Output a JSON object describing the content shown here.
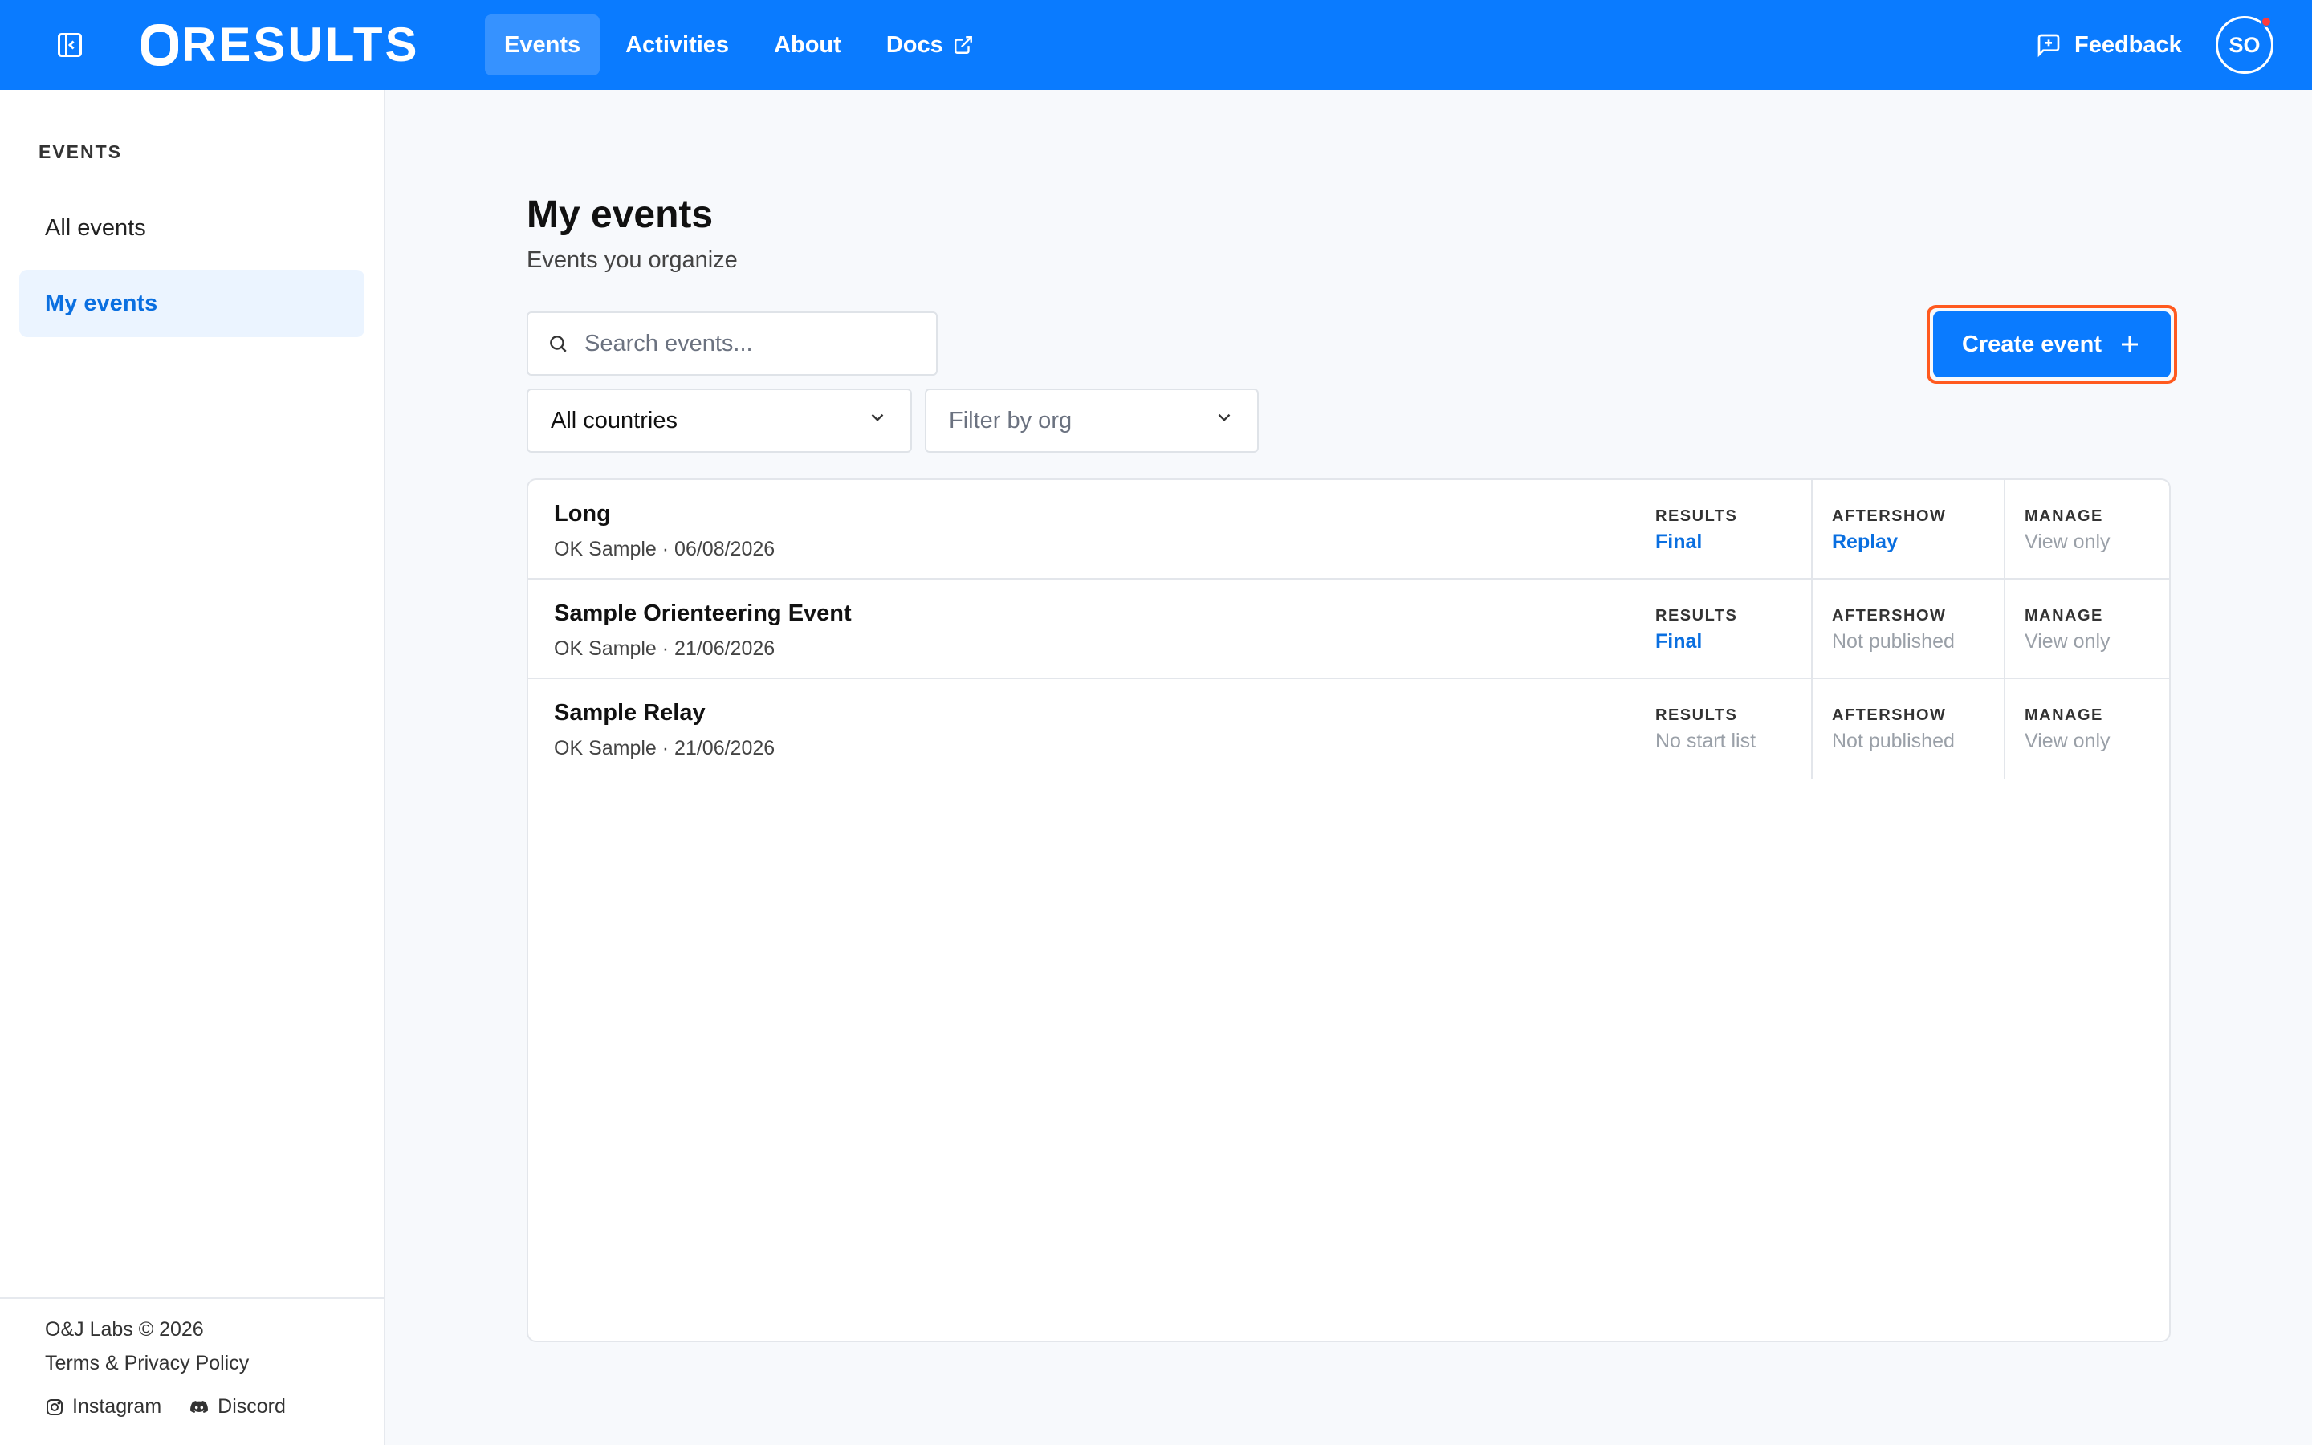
{
  "header": {
    "logo_text": "RESULTS",
    "nav": [
      {
        "label": "Events",
        "active": true
      },
      {
        "label": "Activities"
      },
      {
        "label": "About"
      },
      {
        "label": "Docs"
      }
    ],
    "feedback_label": "Feedback",
    "avatar_initials": "SO",
    "brand_color": "#0a7bff"
  },
  "sidebar": {
    "heading": "EVENTS",
    "items": [
      {
        "label": "All events"
      },
      {
        "label": "My events",
        "active": true
      }
    ],
    "footer": {
      "copyright": "O&J Labs © 2026",
      "terms": "Terms & Privacy Policy",
      "instagram": "Instagram",
      "discord": "Discord"
    }
  },
  "main": {
    "title": "My events",
    "subtitle": "Events you organize",
    "search_placeholder": "Search events...",
    "country_filter": "All countries",
    "org_filter": "Filter by org",
    "create_label": "Create event",
    "columns": {
      "results": "RESULTS",
      "aftershow": "AFTERSHOW",
      "manage": "MANAGE"
    },
    "events": [
      {
        "name": "Long",
        "meta": "OK Sample · 06/08/2026",
        "results": "Final",
        "aftershow": "Replay",
        "manage": "View only"
      },
      {
        "name": "Sample Orienteering Event",
        "meta": "OK Sample · 21/06/2026",
        "results": "Final",
        "aftershow": "Not published",
        "manage": "View only"
      },
      {
        "name": "Sample Relay",
        "meta": "OK Sample · 21/06/2026",
        "results": "No start list",
        "aftershow": "Not published",
        "manage": "View only"
      }
    ]
  }
}
